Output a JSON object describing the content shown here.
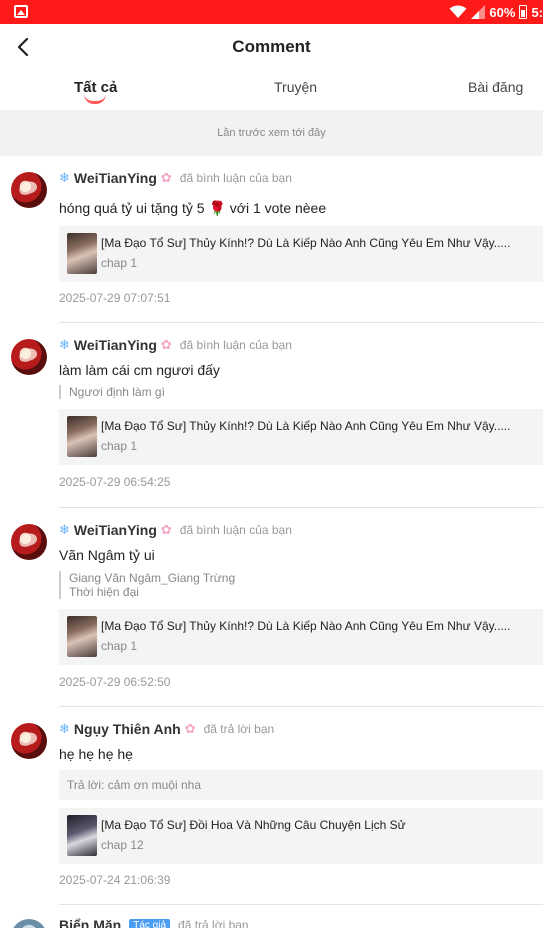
{
  "status_bar": {
    "battery": "60%",
    "time": "5:",
    "color": "#ff1a1a"
  },
  "header": {
    "title": "Comment",
    "back_icon": "arrow-left-icon"
  },
  "tabs": [
    {
      "label": "Tất cả",
      "active": true
    },
    {
      "label": "Truyện",
      "active": false
    },
    {
      "label": "Bài đăng",
      "active": false
    }
  ],
  "notice": "Lần trước xem tới đây",
  "comments": [
    {
      "username": "WeiTianYing",
      "action": "đã bình luận của bạn",
      "text": "hóng quá tỷ ui tặng tỷ 5",
      "text_emoji": "🌹",
      "text_tail": "với 1 vote nèee",
      "story_title": "[Ma Đạo Tổ Sư] Thủy Kính!? Dù Là Kiếp Nào Anh Cũng Yêu Em Như Vậy.....",
      "story_chapter": "chap 1",
      "time": "2025-07-29 07:07:51"
    },
    {
      "username": "WeiTianYing",
      "action": "đã bình luận của bạn",
      "text": "làm làm cái cm ngươi đấy",
      "quote": "Ngươi định làm gì",
      "story_title": "[Ma Đạo Tổ Sư] Thủy Kính!? Dù Là Kiếp Nào Anh Cũng Yêu Em Như Vậy.....",
      "story_chapter": "chap 1",
      "time": "2025-07-29 06:54:25"
    },
    {
      "username": "WeiTianYing",
      "action": "đã bình luận của bạn",
      "text": "Vãn Ngâm tỷ ui",
      "quote_line1": "Giang Vãn Ngâm_Giang Trừng",
      "quote_line2": "Thời hiện đại",
      "story_title": "[Ma Đạo Tổ Sư] Thủy Kính!? Dù Là Kiếp Nào Anh Cũng Yêu Em Như Vậy.....",
      "story_chapter": "chap 1",
      "time": "2025-07-29 06:52:50"
    },
    {
      "username": "Ngụy Thiên Anh",
      "action": "đã trả lời bạn",
      "text": "hẹ hẹ hẹ hẹ",
      "reply": "Trả lời: cảm ơn muội nha",
      "story_title": "[Ma Đạo Tổ Sư] Đồi Hoa Và Những Câu Chuyện Lịch Sử",
      "story_chapter": "chap 12",
      "time": "2025-07-24 21:06:39"
    },
    {
      "username": "Biển Mặn",
      "badge": "Tác giả",
      "action": "đã trả lời bạn"
    }
  ]
}
